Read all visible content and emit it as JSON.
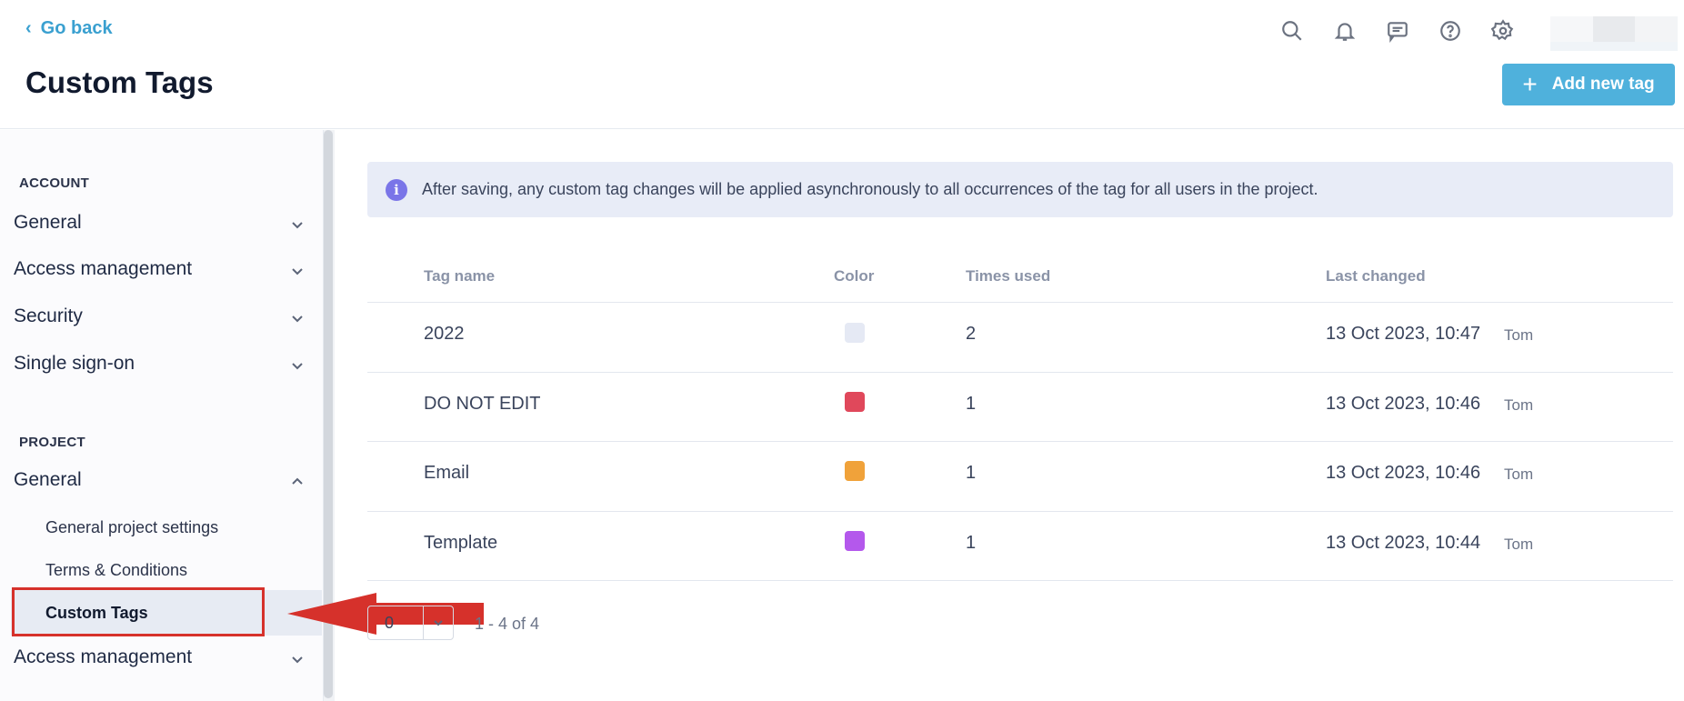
{
  "header": {
    "go_back": "Go back",
    "title": "Custom Tags",
    "add_button": "Add new tag",
    "icons": [
      "search-icon",
      "bell-icon",
      "message-icon",
      "help-icon",
      "gear-icon"
    ]
  },
  "sidebar": {
    "account_label": "ACCOUNT",
    "account_items": [
      "General",
      "Access management",
      "Security",
      "Single sign-on"
    ],
    "project_label": "PROJECT",
    "project_general": "General",
    "project_sub": [
      "General project settings",
      "Terms & Conditions",
      "Custom Tags"
    ],
    "project_access": "Access management"
  },
  "banner": {
    "icon": "i",
    "text": "After saving, any custom tag changes will be applied asynchronously to all occurrences of the tag for all users in the project."
  },
  "table": {
    "headers": [
      "Tag name",
      "Color",
      "Times used",
      "Last changed"
    ],
    "rows": [
      {
        "name": "2022",
        "color": "#e5e9f4",
        "times": "2",
        "changed": "13 Oct 2023, 10:47",
        "by": "Tom"
      },
      {
        "name": "DO NOT EDIT",
        "color": "#e0485b",
        "times": "1",
        "changed": "13 Oct 2023, 10:46",
        "by": "Tom"
      },
      {
        "name": "Email",
        "color": "#f0a23a",
        "times": "1",
        "changed": "13 Oct 2023, 10:46",
        "by": "Tom"
      },
      {
        "name": "Template",
        "color": "#b458ec",
        "times": "1",
        "changed": "13 Oct 2023, 10:44",
        "by": "Tom"
      }
    ]
  },
  "pagination": {
    "page_size": "0",
    "range": "1 - 4 of 4"
  },
  "colors": {
    "accent": "#4fb1dc",
    "annotation": "#d6312b"
  }
}
